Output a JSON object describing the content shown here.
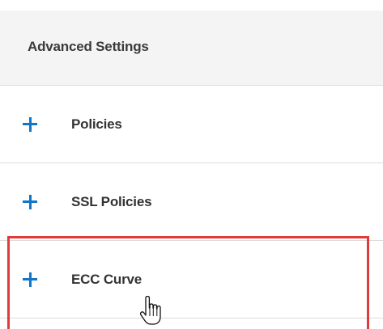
{
  "panel": {
    "title": "Advanced Settings",
    "items": [
      {
        "label": "Policies",
        "icon": "plus-icon"
      },
      {
        "label": "SSL Policies",
        "icon": "plus-icon"
      },
      {
        "label": "ECC Curve",
        "icon": "plus-icon",
        "highlighted": true
      }
    ]
  },
  "colors": {
    "accent": "#1276c8",
    "highlight": "#e23a3a",
    "header_bg": "#f4f4f4",
    "divider": "#dcdcdc"
  },
  "cursor": {
    "icon": "hand-pointer-icon"
  }
}
